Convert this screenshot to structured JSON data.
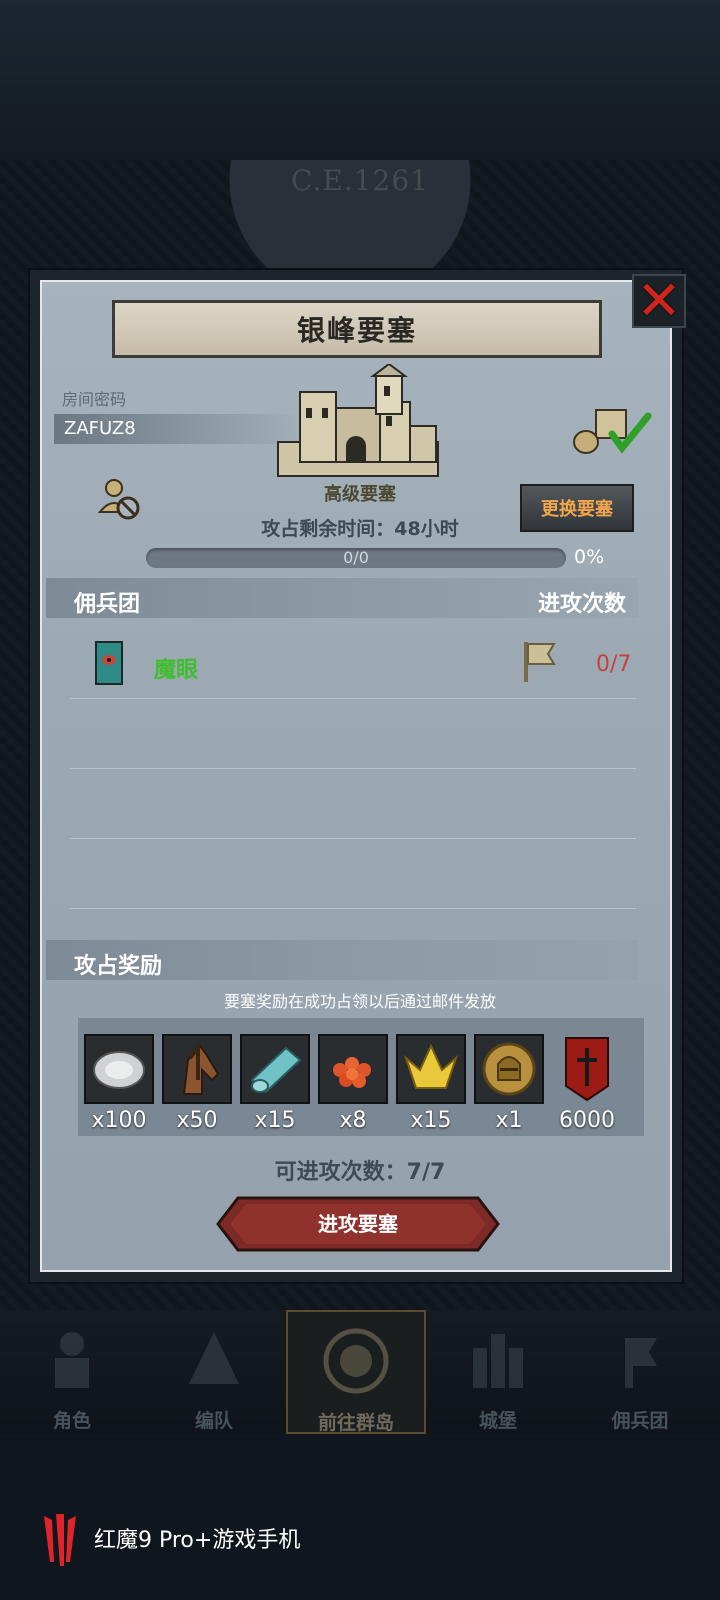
{
  "background": {
    "era": "C.E.1261"
  },
  "dialog": {
    "title": "银峰要塞",
    "close_icon": "close-x-icon",
    "room_code_label": "房间密码",
    "room_code": "ZAFUZ8",
    "fortress_type": "高级要塞",
    "time_left": "攻占剩余时间：48小时",
    "progress_text": "0/0",
    "progress_percent": "0%",
    "progress_fraction": 0,
    "change_button": "更换要塞",
    "mercenary_header": "佣兵团",
    "attack_count_header": "进攻次数",
    "mercenaries": [
      {
        "name": "魔眼",
        "count": "0/7"
      }
    ],
    "rewards_header": "攻占奖励",
    "reward_note": "要塞奖励在成功占领以后通过邮件发放",
    "rewards": [
      {
        "icon": "oyster-icon",
        "qty": "x100"
      },
      {
        "icon": "horse-icon",
        "qty": "x50"
      },
      {
        "icon": "cloth-icon",
        "qty": "x15"
      },
      {
        "icon": "fish-roe-icon",
        "qty": "x8"
      },
      {
        "icon": "crown-icon",
        "qty": "x15"
      },
      {
        "icon": "knight-medal-icon",
        "qty": "x1"
      },
      {
        "icon": "banner-icon",
        "qty": "6000"
      }
    ],
    "attacks_available": "可进攻次数：7/7",
    "attack_button": "进攻要塞"
  },
  "nav": {
    "items": [
      {
        "label": "角色",
        "icon": "character-icon"
      },
      {
        "label": "编队",
        "icon": "formation-icon"
      },
      {
        "label": "前往群岛",
        "icon": "compass-icon",
        "active": true
      },
      {
        "label": "城堡",
        "icon": "castle-icon"
      },
      {
        "label": "佣兵团",
        "icon": "mercenary-icon"
      }
    ]
  },
  "watermark": {
    "text": "红魔9 Pro+游戏手机"
  },
  "colors": {
    "accent_orange": "#f2a64c",
    "merc_green": "#3fbe2f",
    "count_red": "#c8413c",
    "close_red": "#d1241a"
  }
}
